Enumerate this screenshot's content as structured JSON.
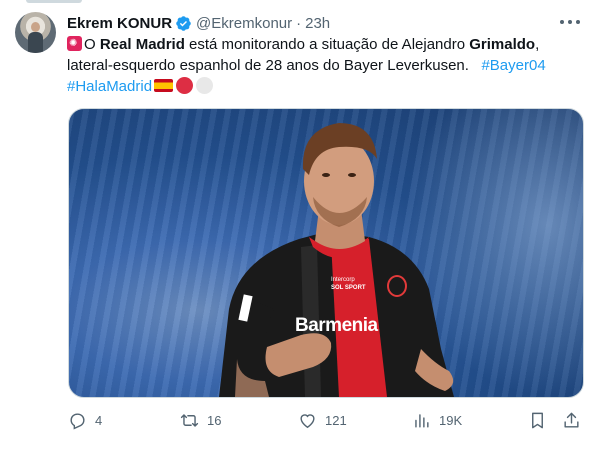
{
  "author": {
    "name": "Ekrem KONUR",
    "handle": "@Ekremkonur",
    "separator": "·",
    "time": "23h"
  },
  "tweet": {
    "line1_prefix": "O ",
    "line1_bold1": "Real Madrid",
    "line1_mid": " está monitorando a situação de Alejandro ",
    "line1_bold2": "Grimaldo",
    "line1_suffix": ",",
    "line2_text": "lateral-esquerdo espanhol de 28 anos do Bayer Leverkusen.   ",
    "line2_tag": "#Bayer04",
    "line3_tag": "#HalaMadrid"
  },
  "media": {
    "jersey_sponsor": "Barmenia",
    "shirt_patch": "SOL SPORT",
    "shirt_patch_small": "Intercorp"
  },
  "actions": {
    "reply_count": "4",
    "retweet_count": "16",
    "like_count": "121",
    "view_count": "19K"
  },
  "colors": {
    "accent": "#1d9bf0",
    "muted": "#536471",
    "jersey_red": "#d6202b",
    "jersey_black": "#1a1a1a"
  },
  "icons": [
    "verified-badge-icon",
    "more-icon",
    "reply-icon",
    "retweet-icon",
    "like-icon",
    "views-icon",
    "bookmark-icon",
    "share-icon"
  ]
}
